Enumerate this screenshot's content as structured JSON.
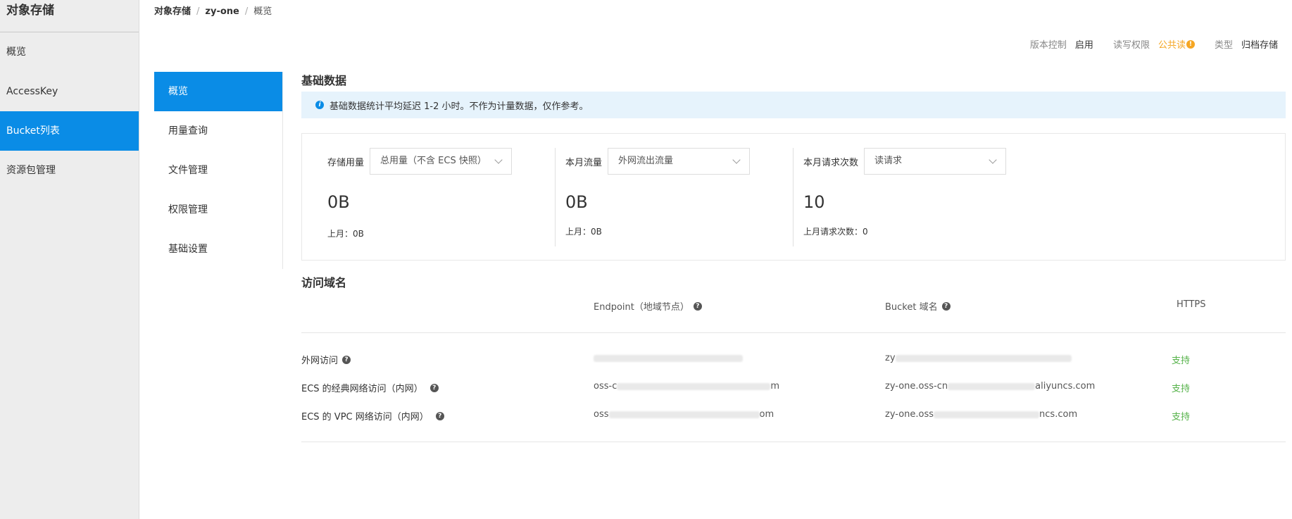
{
  "sidebar": {
    "title": "对象存储",
    "items": [
      {
        "label": "概览",
        "active": false
      },
      {
        "label": "AccessKey",
        "active": false
      },
      {
        "label": "Bucket列表",
        "active": true
      },
      {
        "label": "资源包管理",
        "active": false
      }
    ]
  },
  "breadcrumb": {
    "root": "对象存储",
    "bucket": "zy-one",
    "current": "概览",
    "separator": "/"
  },
  "bucket_status": {
    "versioning_label": "版本控制",
    "versioning_value": "启用",
    "acl_label": "读写权限",
    "acl_value": "公共读",
    "acl_warn_icon": "!",
    "type_label": "类型",
    "type_value": "归档存储"
  },
  "subnav": {
    "items": [
      {
        "label": "概览",
        "active": true
      },
      {
        "label": "用量查询",
        "active": false
      },
      {
        "label": "文件管理",
        "active": false
      },
      {
        "label": "权限管理",
        "active": false
      },
      {
        "label": "基础设置",
        "active": false
      }
    ]
  },
  "basic_data": {
    "title": "基础数据",
    "info_icon": "i",
    "notice": "基础数据统计平均延迟 1-2 小时。不作为计量数据，仅作参考。",
    "stats": [
      {
        "label": "存储用量",
        "select": "总用量（不含 ECS 快照）",
        "value": "0B",
        "prev": "上月：0B"
      },
      {
        "label": "本月流量",
        "select": "外网流出流量",
        "value": "0B",
        "prev": "上月：0B"
      },
      {
        "label": "本月请求次数",
        "select": "读请求",
        "value": "10",
        "prev": "上月请求次数：0"
      }
    ]
  },
  "domains": {
    "title": "访问域名",
    "help_icon": "?",
    "columns": {
      "endpoint": "Endpoint（地域节点）",
      "bucket_domain": "Bucket 域名",
      "https": "HTTPS"
    },
    "rows": [
      {
        "label": "外网访问",
        "endpoint_visible": "",
        "bucket_domain_visible": "zy",
        "https": "支持"
      },
      {
        "label": "ECS 的经典网络访问（内网）",
        "endpoint_visible": "oss-c",
        "endpoint_tail": "m",
        "bucket_domain_visible": "zy-one.oss-cn",
        "bucket_domain_tail": "aliyuncs.com",
        "https": "支持"
      },
      {
        "label": "ECS 的 VPC 网络访问（内网）",
        "endpoint_visible": "oss",
        "endpoint_tail": "om",
        "bucket_domain_visible": "zy-one.oss",
        "bucket_domain_tail": "ncs.com",
        "https": "支持"
      }
    ]
  },
  "colors": {
    "primary": "#0a8ce6",
    "warning": "#f5a623",
    "success": "#55b249",
    "info_bg": "#e6f3fc"
  }
}
